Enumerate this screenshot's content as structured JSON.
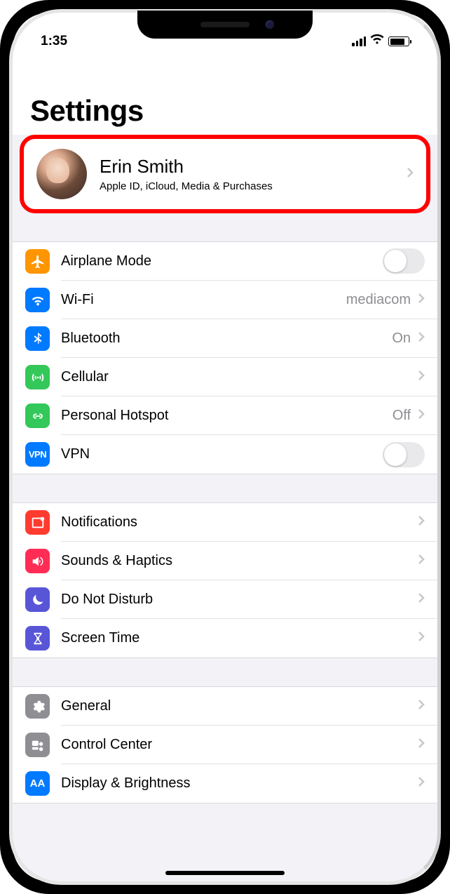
{
  "status": {
    "time": "1:35"
  },
  "header": {
    "title": "Settings"
  },
  "profile": {
    "name": "Erin Smith",
    "subtitle": "Apple ID, iCloud, Media & Purchases"
  },
  "groups": [
    {
      "rows": [
        {
          "icon": "airplane",
          "color": "#ff9500",
          "label": "Airplane Mode",
          "value": "",
          "accessory": "toggle"
        },
        {
          "icon": "wifi",
          "color": "#007aff",
          "label": "Wi-Fi",
          "value": "mediacom",
          "accessory": "chevron"
        },
        {
          "icon": "bluetooth",
          "color": "#007aff",
          "label": "Bluetooth",
          "value": "On",
          "accessory": "chevron"
        },
        {
          "icon": "cellular",
          "color": "#34c759",
          "label": "Cellular",
          "value": "",
          "accessory": "chevron"
        },
        {
          "icon": "hotspot",
          "color": "#34c759",
          "label": "Personal Hotspot",
          "value": "Off",
          "accessory": "chevron"
        },
        {
          "icon": "vpn",
          "color": "#007aff",
          "label": "VPN",
          "value": "",
          "accessory": "toggle"
        }
      ]
    },
    {
      "rows": [
        {
          "icon": "notifications",
          "color": "#ff3b30",
          "label": "Notifications",
          "value": "",
          "accessory": "chevron"
        },
        {
          "icon": "sounds",
          "color": "#ff2d55",
          "label": "Sounds & Haptics",
          "value": "",
          "accessory": "chevron"
        },
        {
          "icon": "dnd",
          "color": "#5856d6",
          "label": "Do Not Disturb",
          "value": "",
          "accessory": "chevron"
        },
        {
          "icon": "screentime",
          "color": "#5856d6",
          "label": "Screen Time",
          "value": "",
          "accessory": "chevron"
        }
      ]
    },
    {
      "rows": [
        {
          "icon": "general",
          "color": "#8e8e93",
          "label": "General",
          "value": "",
          "accessory": "chevron"
        },
        {
          "icon": "controlcenter",
          "color": "#8e8e93",
          "label": "Control Center",
          "value": "",
          "accessory": "chevron"
        },
        {
          "icon": "display",
          "color": "#007aff",
          "label": "Display & Brightness",
          "value": "",
          "accessory": "chevron"
        }
      ]
    }
  ]
}
